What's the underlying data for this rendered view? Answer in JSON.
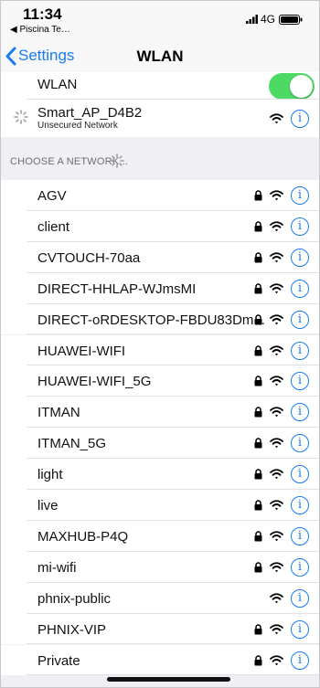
{
  "status": {
    "time": "11:34",
    "back_app": "◀ Piscina Te…",
    "network": "4G"
  },
  "nav": {
    "back_label": "Settings",
    "title": "WLAN"
  },
  "wlan": {
    "label": "WLAN",
    "enabled": true
  },
  "connecting": {
    "ssid": "Smart_AP_D4B2",
    "status": "Unsecured Network"
  },
  "section": {
    "header": "CHOOSE A NETWORK..."
  },
  "networks": [
    {
      "ssid": "AGV",
      "locked": true
    },
    {
      "ssid": "client",
      "locked": true
    },
    {
      "ssid": "CVTOUCH-70aa",
      "locked": true
    },
    {
      "ssid": "DIRECT-HHLAP-WJmsMI",
      "locked": true
    },
    {
      "ssid": "DIRECT-oRDESKTOP-FBDU83Dm...",
      "locked": true
    },
    {
      "ssid": "HUAWEI-WIFI",
      "locked": true
    },
    {
      "ssid": "HUAWEI-WIFI_5G",
      "locked": true
    },
    {
      "ssid": "ITMAN",
      "locked": true
    },
    {
      "ssid": "ITMAN_5G",
      "locked": true
    },
    {
      "ssid": "light",
      "locked": true
    },
    {
      "ssid": "live",
      "locked": true
    },
    {
      "ssid": "MAXHUB-P4Q",
      "locked": true
    },
    {
      "ssid": "mi-wifi",
      "locked": true
    },
    {
      "ssid": "phnix-public",
      "locked": false
    },
    {
      "ssid": "PHNIX-VIP",
      "locked": true
    },
    {
      "ssid": "Private",
      "locked": true
    }
  ],
  "colors": {
    "accent": "#1a7cf0",
    "toggle_on": "#4cd964",
    "background": "#efeff4"
  }
}
